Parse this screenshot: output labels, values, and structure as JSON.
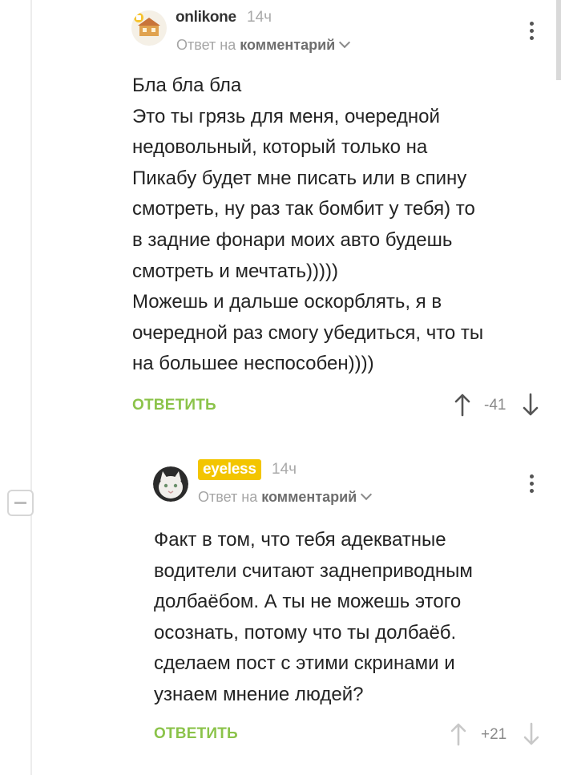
{
  "comments": [
    {
      "username": "onlikone",
      "time": "14ч",
      "reply_prefix": "Ответ на",
      "reply_target": "комментарий",
      "lines": [
        "Бла бла бла",
        "Это ты грязь для меня, очередной",
        "недовольный, который только на",
        "Пикабу будет мне писать или в спину",
        "смотреть, ну раз так бомбит у тебя) то",
        "в задние фонари моих авто будешь",
        "смотреть и мечтать)))))",
        "Можешь и дальше оскорблять, я в",
        "очередной раз смогу убедиться, что ты",
        "на большее неспособен))))"
      ],
      "reply_label": "ОТВЕТИТЬ",
      "score": "-41"
    },
    {
      "username": "eyeless",
      "time": "14ч",
      "reply_prefix": "Ответ на",
      "reply_target": "комментарий",
      "lines": [
        "Факт в том, что тебя адекватные",
        "водители считают заднеприводным",
        "долбаёбом. А ты не можешь этого",
        "осознать, потому что ты долбаёб.",
        "сделаем пост с этими скринами и",
        "узнаем мнение людей?"
      ],
      "reply_label": "ОТВЕТИТЬ",
      "score": "+21"
    }
  ],
  "colors": {
    "accent_green": "#8bc34a",
    "username_badge": "#f3c500",
    "muted": "#a9a9a9"
  },
  "icons": [
    "more-vert-icon",
    "arrow-up-icon",
    "arrow-down-icon",
    "collapse-icon",
    "chevron-down-icon"
  ]
}
